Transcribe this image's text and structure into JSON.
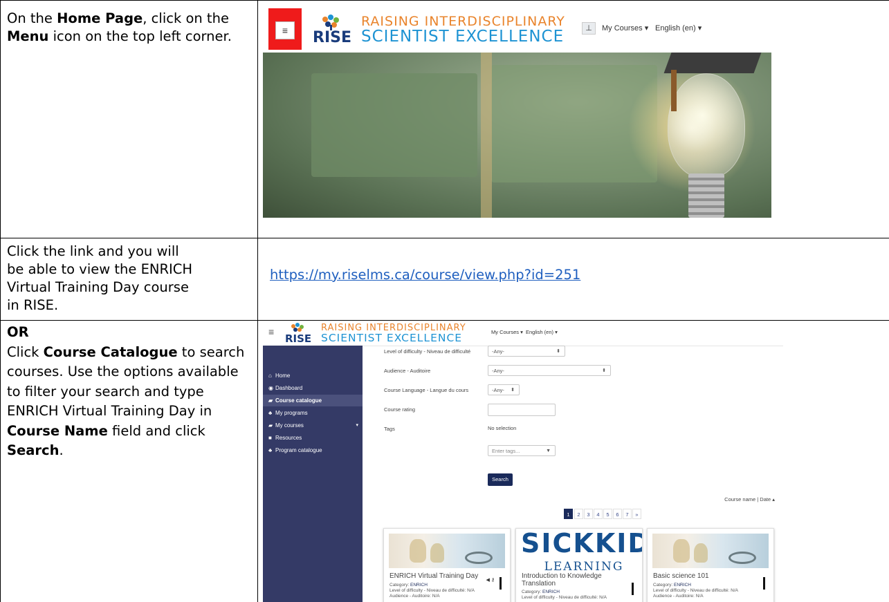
{
  "rows": [
    {
      "instruction_parts": [
        "On the ",
        "Home Page",
        ", click on the ",
        "Menu",
        " icon on the top left corner."
      ]
    },
    {
      "instruction": [
        "Click the link and you will",
        "be able to view the ENRICH",
        "Virtual Training Day course",
        "in RISE."
      ],
      "link": "https://my.riselms.ca/course/view.php?id=251"
    },
    {
      "or": "OR",
      "instruction_parts": [
        "Click ",
        "Course Catalogue",
        " to search courses. Use the options available to filter your search and type ENRICH Virtual Training Day in ",
        "Course Name",
        " field and click ",
        "Search",
        "."
      ]
    }
  ],
  "logo": {
    "line1": "RAISING INTERDISCIPLINARY",
    "line2": "SCIENTIST EXCELLENCE",
    "mark": "RISE"
  },
  "shot1": {
    "menu_icon": "≡",
    "nav_icon": "sitemap-icon",
    "my_courses": "My Courses ▾",
    "language": "English (en) ▾",
    "colors": {
      "highlight": "#ef1b1b"
    }
  },
  "shot2": {
    "menu_icon": "≡",
    "my_courses": "My Courses ▾",
    "language": "English (en) ▾",
    "sidebar": [
      {
        "icon": "⌂",
        "label": "Home"
      },
      {
        "icon": "◉",
        "label": "Dashboard"
      },
      {
        "icon": "▰",
        "label": "Course catalogue",
        "active": true
      },
      {
        "icon": "♣",
        "label": "My programs"
      },
      {
        "icon": "▰",
        "label": "My courses",
        "caret": "▾"
      },
      {
        "icon": "■",
        "label": "Resources"
      },
      {
        "icon": "♣",
        "label": "Program catalogue"
      }
    ],
    "filters": [
      {
        "label": "Level of difficulty - Niveau de difficulté",
        "value": "-Any-"
      },
      {
        "label": "Audience - Auditoire",
        "value": "-Any-"
      },
      {
        "label": "Course Language - Langue du cours",
        "value": "-Any-"
      },
      {
        "label": "Course rating",
        "value": ""
      },
      {
        "label": "Tags",
        "value": "No selection"
      }
    ],
    "tags_placeholder": "Enter tags...",
    "search_label": "Search",
    "sort_label": "Course name | Date ▴",
    "pages": [
      "1",
      "2",
      "3",
      "4",
      "5",
      "6",
      "7",
      "»"
    ],
    "cards": [
      {
        "title": "ENRICH Virtual Training Day",
        "category_label": "Category: ",
        "category": "ENRICH",
        "difficulty": "Level of difficulty - Niveau de difficulté: N/A",
        "audience": "Audience - Auditoire: N/A"
      },
      {
        "banner_big": "SICKKIDS",
        "banner_small": "LEARNING",
        "title": "Introduction to Knowledge Translation",
        "category_label": "Category: ",
        "category": "ENRICH",
        "difficulty": "Level of difficulty - Niveau de difficulté: N/A"
      },
      {
        "title": "Basic science 101",
        "category_label": "Category: ",
        "category": "ENRICH",
        "difficulty": "Level of difficulty - Niveau de difficulté: N/A",
        "audience": "Audience - Auditoire: N/A"
      }
    ]
  }
}
